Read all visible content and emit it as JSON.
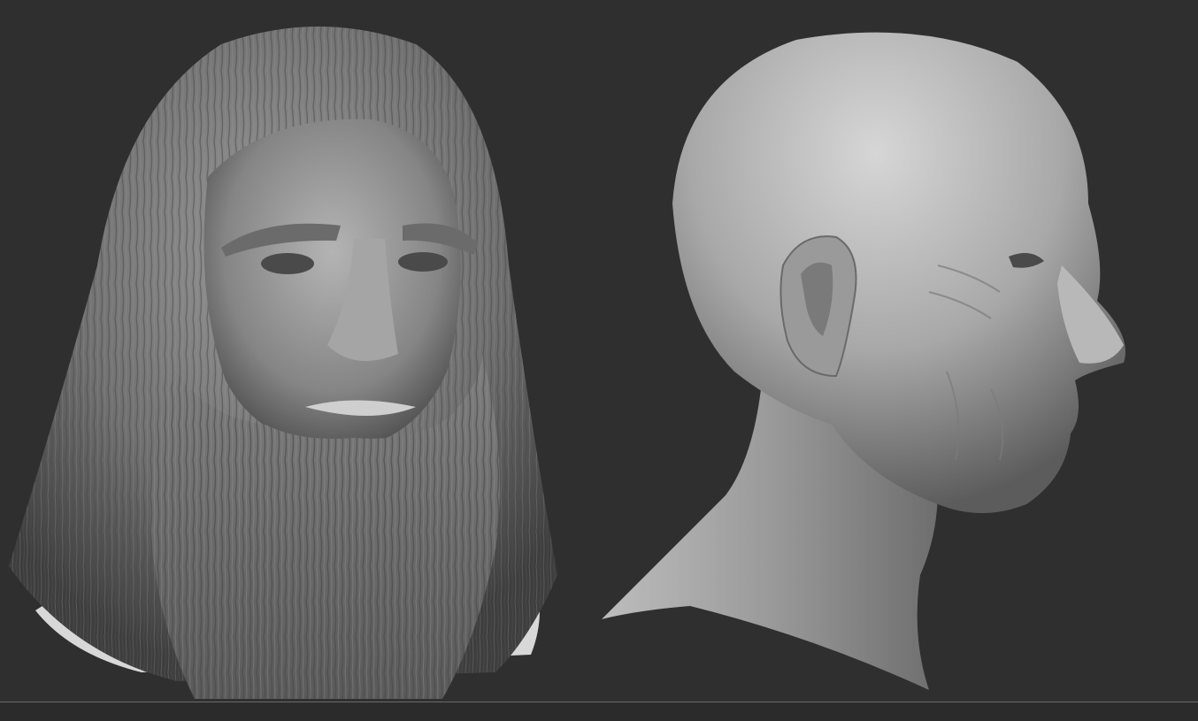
{
  "canvas": {
    "background_color": "#2f2f2f",
    "floor_line_color": "#6a6a6a"
  },
  "models": {
    "bearded_head": {
      "view": "front",
      "material_color": "#8c8c8c"
    },
    "bald_head": {
      "view": "side",
      "material_color": "#a6a6a6"
    }
  }
}
